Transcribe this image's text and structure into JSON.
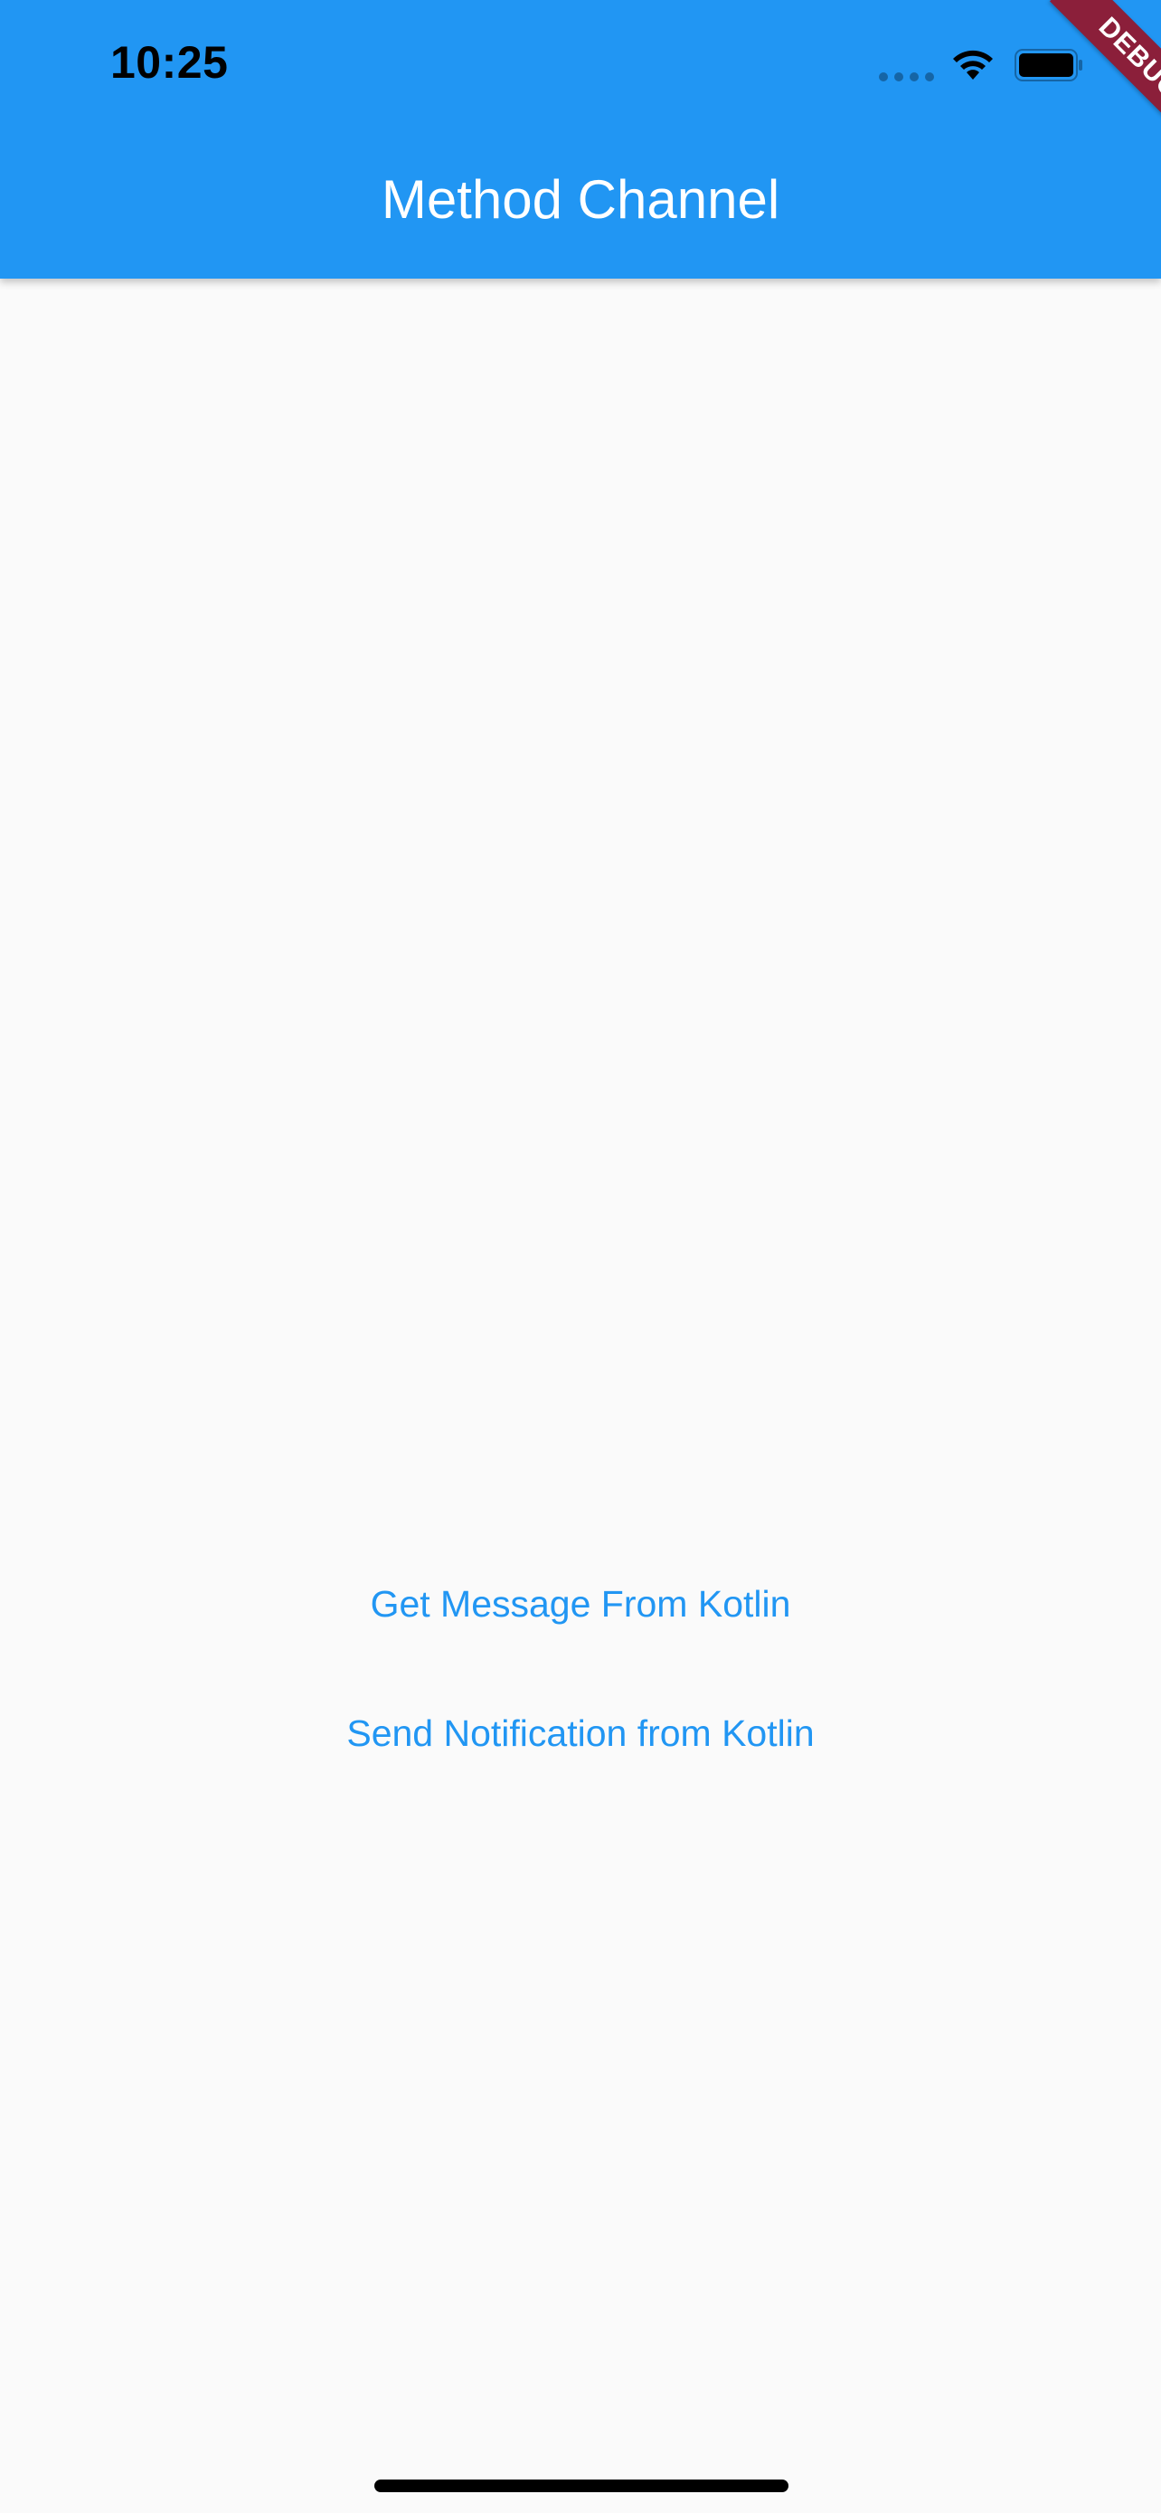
{
  "status_bar": {
    "time": "10:25"
  },
  "debug_banner": {
    "label": "DEBUG"
  },
  "app_bar": {
    "title": "Method Channel"
  },
  "buttons": {
    "get_message": "Get Message From Kotlin",
    "send_notification": "Send Notification from Kotlin"
  },
  "colors": {
    "primary": "#2196f3",
    "background": "#fafafa",
    "banner": "#8b1f3a"
  },
  "icons": {
    "signal": "signal-dots-icon",
    "wifi": "wifi-icon",
    "battery": "battery-icon"
  }
}
